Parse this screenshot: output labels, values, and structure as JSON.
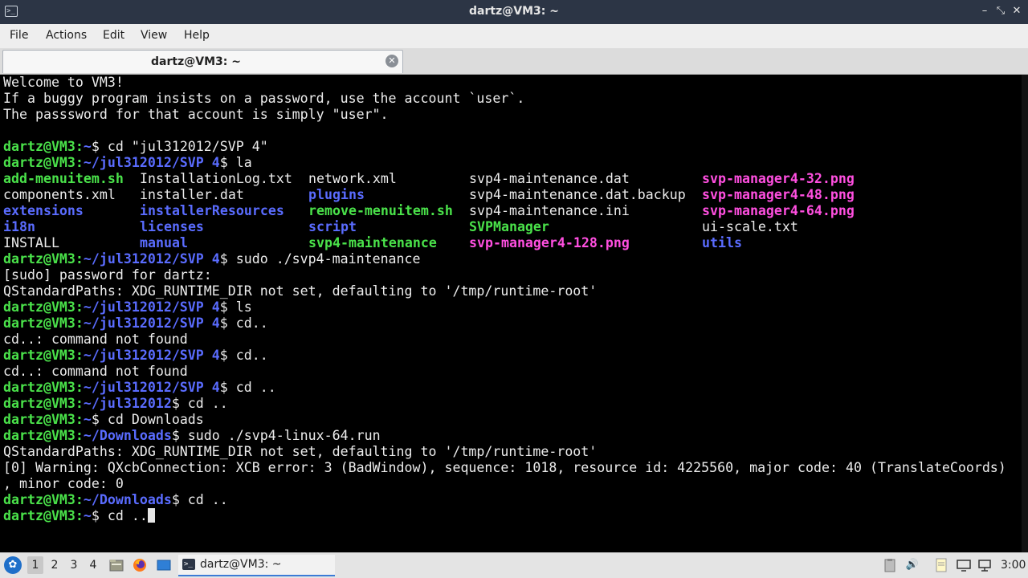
{
  "window": {
    "title": "dartz@VM3: ~",
    "icon": "terminal-icon"
  },
  "menubar": {
    "items": [
      "File",
      "Actions",
      "Edit",
      "View",
      "Help"
    ]
  },
  "tab": {
    "label": "dartz@VM3: ~",
    "close_icon": "close-icon"
  },
  "terminal": {
    "lines": [
      "Welcome to VM3!",
      "If a buggy program insists on a password, use the account `user`.",
      "The passsword for that account is simply \"user\".",
      "",
      {
        "user": "dartz@VM3",
        "path": "~",
        "cmd": "$ cd \"jul312012/SVP 4\""
      },
      {
        "user": "dartz@VM3",
        "path": "~/jul312012/SVP 4",
        "cmd": "$ la"
      },
      "",
      "",
      "",
      "",
      "",
      {
        "user": "dartz@VM3",
        "path": "~/jul312012/SVP 4",
        "cmd": "$ sudo ./svp4-maintenance"
      },
      "[sudo] password for dartz:",
      "QStandardPaths: XDG_RUNTIME_DIR not set, defaulting to '/tmp/runtime-root'",
      {
        "user": "dartz@VM3",
        "path": "~/jul312012/SVP 4",
        "cmd": "$ ls"
      },
      {
        "user": "dartz@VM3",
        "path": "~/jul312012/SVP 4",
        "cmd": "$ cd.."
      },
      "cd..: command not found",
      {
        "user": "dartz@VM3",
        "path": "~/jul312012/SVP 4",
        "cmd": "$ cd.."
      },
      "cd..: command not found",
      {
        "user": "dartz@VM3",
        "path": "~/jul312012/SVP 4",
        "cmd": "$ cd .."
      },
      {
        "user": "dartz@VM3",
        "path": "~/jul312012",
        "cmd": "$ cd .."
      },
      {
        "user": "dartz@VM3",
        "path": "~",
        "cmd": "$ cd Downloads"
      },
      {
        "user": "dartz@VM3",
        "path": "~/Downloads",
        "cmd": "$ sudo ./svp4-linux-64.run"
      },
      "QStandardPaths: XDG_RUNTIME_DIR not set, defaulting to '/tmp/runtime-root'",
      "[0] Warning: QXcbConnection: XCB error: 3 (BadWindow), sequence: 1018, resource id: 4225560, major code: 40 (TranslateCoords)",
      ", minor code: 0",
      {
        "user": "dartz@VM3",
        "path": "~/Downloads",
        "cmd": "$ cd .."
      },
      {
        "user": "dartz@VM3",
        "path": "~",
        "cmd": "$ cd ..",
        "cursor": true
      }
    ],
    "ls_listing": [
      [
        "add-menuitem.sh",
        "components.xml",
        "extensions",
        "i18n",
        "INSTALL"
      ],
      [
        "InstallationLog.txt",
        "installer.dat",
        "installerResources",
        "licenses",
        "manual"
      ],
      [
        "network.xml",
        "plugins",
        "remove-menuitem.sh",
        "script",
        "svp4-maintenance"
      ],
      [
        "svp4-maintenance.dat",
        "svp4-maintenance.dat.backup",
        "svp4-maintenance.ini",
        "SVPManager",
        "svp-manager4-128.png"
      ],
      [
        "svp-manager4-32.png",
        "svp-manager4-48.png",
        "svp-manager4-64.png",
        "ui-scale.txt",
        "utils"
      ]
    ],
    "ls_types": [
      [
        "exec",
        "file",
        "dir",
        "dir",
        "file"
      ],
      [
        "file",
        "file",
        "dir",
        "dir",
        "dir"
      ],
      [
        "file",
        "dir",
        "exec",
        "dir",
        "exec"
      ],
      [
        "file",
        "file",
        "file",
        "exec",
        "img"
      ],
      [
        "img",
        "img",
        "img",
        "file",
        "dir"
      ]
    ],
    "colors": {
      "user": "#4ae24a",
      "path": "#5a6cff",
      "dir": "#5a6cff",
      "exec": "#4ae24a",
      "img": "#ff4fe0",
      "text": "#ececec"
    }
  },
  "taskbar": {
    "workspaces": [
      "1",
      "2",
      "3",
      "4"
    ],
    "active_workspace": "1",
    "launchers": [
      "file-manager-icon",
      "firefox-icon",
      "desktop-icon"
    ],
    "task_label": "dartz@VM3: ~",
    "tray_icons": [
      "clipboard-icon",
      "volume-icon",
      "notes-icon",
      "monitor-icon",
      "network-icon"
    ],
    "clock": "3:00"
  }
}
